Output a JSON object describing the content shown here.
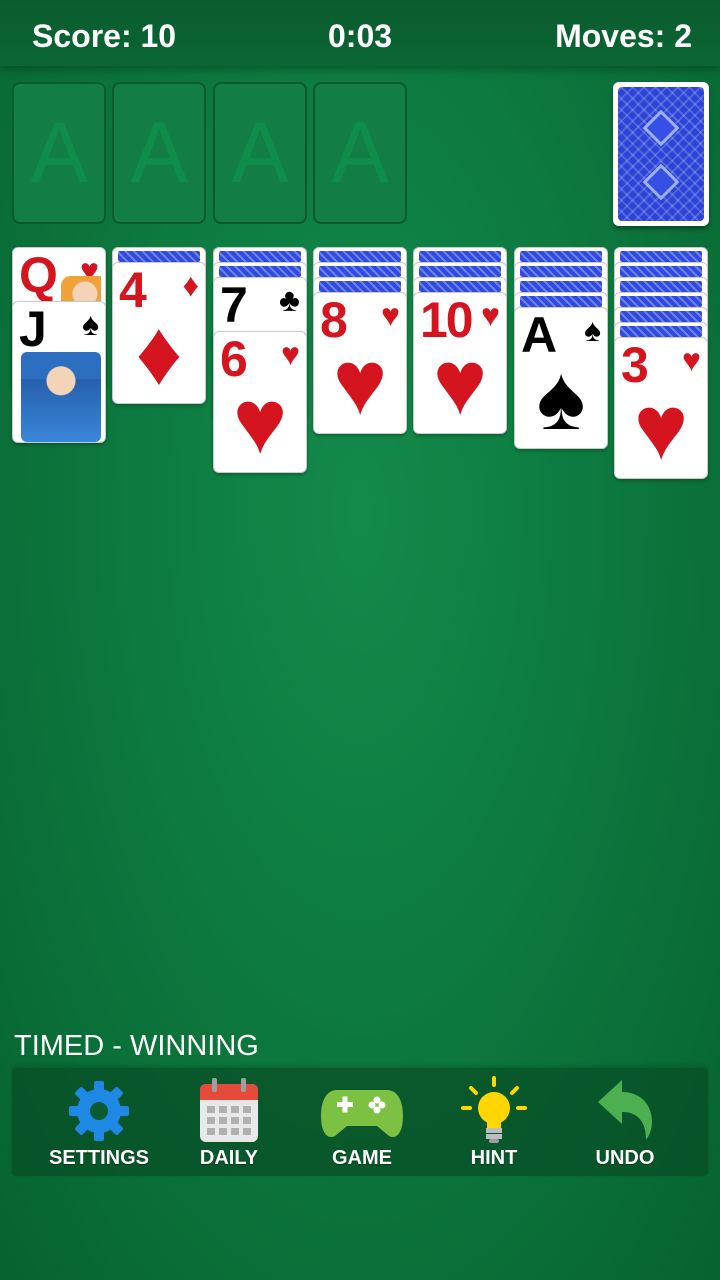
{
  "header": {
    "score": "Score: 10",
    "timer": "0:03",
    "moves": "Moves: 2"
  },
  "foundations": [
    {
      "label": "A"
    },
    {
      "label": "A"
    },
    {
      "label": "A"
    },
    {
      "label": "A"
    }
  ],
  "tableau": [
    {
      "face_down": 0,
      "face_up": [
        {
          "rank": "Q",
          "suit": "hearts"
        },
        {
          "rank": "J",
          "suit": "spades"
        }
      ]
    },
    {
      "face_down": 1,
      "face_up": [
        {
          "rank": "4",
          "suit": "diamonds"
        }
      ]
    },
    {
      "face_down": 2,
      "face_up": [
        {
          "rank": "7",
          "suit": "clubs"
        },
        {
          "rank": "6",
          "suit": "hearts"
        }
      ]
    },
    {
      "face_down": 3,
      "face_up": [
        {
          "rank": "8",
          "suit": "hearts"
        }
      ]
    },
    {
      "face_down": 3,
      "face_up": [
        {
          "rank": "10",
          "suit": "hearts"
        }
      ]
    },
    {
      "face_down": 4,
      "face_up": [
        {
          "rank": "A",
          "suit": "spades"
        }
      ]
    },
    {
      "face_down": 6,
      "face_up": [
        {
          "rank": "3",
          "suit": "hearts"
        }
      ]
    }
  ],
  "status_text": "TIMED - WINNING",
  "toolbar": {
    "settings_label": "SETTINGS",
    "daily_label": "DAILY",
    "game_label": "GAME",
    "hint_label": "HINT",
    "undo_label": "UNDO"
  },
  "icons": {
    "settings": "gear-icon",
    "daily": "calendar-icon",
    "game": "gamepad-icon",
    "hint": "lightbulb-icon",
    "undo": "undo-arrow-icon"
  },
  "colors": {
    "felt": "#0d7a3f",
    "card_red": "#d4141f",
    "card_back": "#2b43d6"
  }
}
